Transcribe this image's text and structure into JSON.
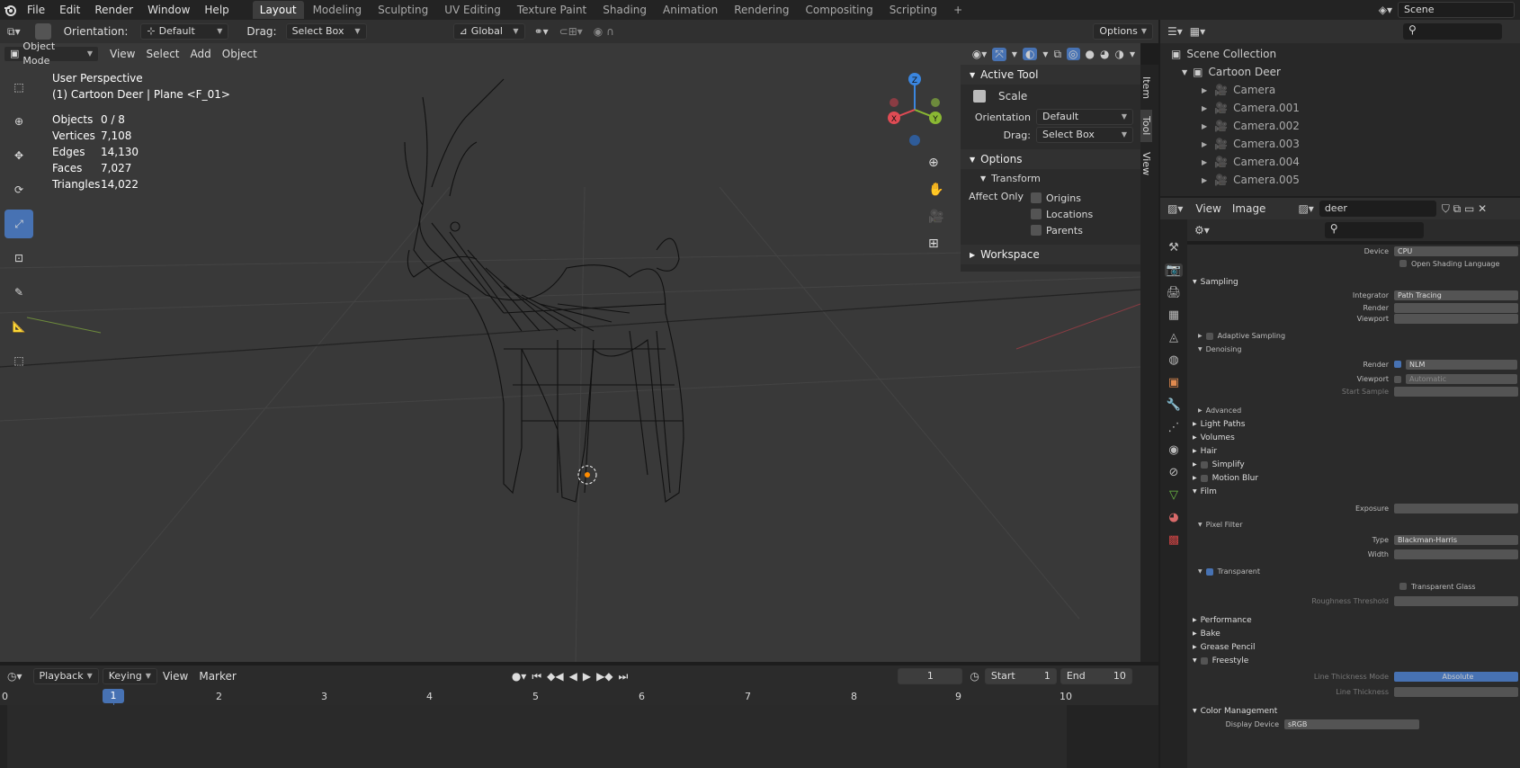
{
  "menubar": {
    "items": [
      "File",
      "Edit",
      "Render",
      "Window",
      "Help"
    ],
    "workspaces": [
      "Layout",
      "Modeling",
      "Sculpting",
      "UV Editing",
      "Texture Paint",
      "Shading",
      "Animation",
      "Rendering",
      "Compositing",
      "Scripting"
    ],
    "active_workspace": "Layout",
    "add_tab": "+",
    "scene": "Scene"
  },
  "tool_header": {
    "orientation_label": "Orientation:",
    "orientation_value": "Default",
    "drag_label": "Drag:",
    "drag_value": "Select Box",
    "transform_orientation": "Global",
    "options": "Options"
  },
  "viewport_header": {
    "mode": "Object Mode",
    "menus": [
      "View",
      "Select",
      "Add",
      "Object"
    ]
  },
  "overlay": {
    "view_name": "User Perspective",
    "object_line": "(1) Cartoon Deer | Plane <F_01>",
    "stats": [
      {
        "label": "Objects",
        "value": "0 / 8"
      },
      {
        "label": "Vertices",
        "value": "7,108"
      },
      {
        "label": "Edges",
        "value": "14,130"
      },
      {
        "label": "Faces",
        "value": "7,027"
      },
      {
        "label": "Triangles",
        "value": "14,022"
      }
    ]
  },
  "gizmo": {
    "x": "X",
    "y": "Y",
    "z": "Z"
  },
  "npanel": {
    "active_tool": "Active Tool",
    "tool_name": "Scale",
    "orientation_label": "Orientation",
    "orientation_value": "Default",
    "drag_label": "Drag:",
    "drag_value": "Select Box",
    "options": "Options",
    "transform": "Transform",
    "affect_only": "Affect Only",
    "origins": "Origins",
    "locations": "Locations",
    "parents": "Parents",
    "workspace": "Workspace",
    "tabs": [
      "Item",
      "Tool",
      "View"
    ]
  },
  "outliner": {
    "root": "Scene Collection",
    "collection": "Cartoon Deer",
    "items": [
      "Camera",
      "Camera.001",
      "Camera.002",
      "Camera.003",
      "Camera.004",
      "Camera.005"
    ]
  },
  "image_header": {
    "menus": [
      "View",
      "Image"
    ],
    "image_name": "deer"
  },
  "properties": {
    "device_label": "Device",
    "device_value": "CPU",
    "osl": "Open Shading Language",
    "sampling": "Sampling",
    "integrator_label": "Integrator",
    "integrator_value": "Path Tracing",
    "render_label": "Render",
    "viewport_label": "Viewport",
    "adaptive": "Adaptive Sampling",
    "denoising": "Denoising",
    "den_render_label": "Render",
    "den_render_value": "NLM",
    "den_viewport_label": "Viewport",
    "den_viewport_value": "Automatic",
    "start_sample": "Start Sample",
    "advanced": "Advanced",
    "light_paths": "Light Paths",
    "volumes": "Volumes",
    "hair": "Hair",
    "simplify": "Simplify",
    "motion_blur": "Motion Blur",
    "film": "Film",
    "exposure": "Exposure",
    "pixel_filter": "Pixel Filter",
    "type_label": "Type",
    "type_value": "Blackman-Harris",
    "width_label": "Width",
    "transparent": "Transparent",
    "transparent_glass": "Transparent Glass",
    "roughness": "Roughness Threshold",
    "performance": "Performance",
    "bake": "Bake",
    "grease_pencil": "Grease Pencil",
    "freestyle": "Freestyle",
    "line_mode_label": "Line Thickness Mode",
    "line_mode_value": "Absolute",
    "line_thickness": "Line Thickness",
    "color_mgmt": "Color Management",
    "display_device": "Display Device",
    "display_value": "sRGB"
  },
  "timeline": {
    "menus": [
      "Playback",
      "Keying",
      "View",
      "Marker"
    ],
    "current_frame": "1",
    "start_label": "Start",
    "start_value": "1",
    "end_label": "End",
    "end_value": "10",
    "ruler": [
      "0",
      "1",
      "2",
      "3",
      "4",
      "5",
      "6",
      "7",
      "8",
      "9",
      "10"
    ]
  },
  "colors": {
    "accent": "#4772b3",
    "x_axis": "#e04b54",
    "y_axis": "#8ab833",
    "z_axis": "#3a86e0"
  }
}
